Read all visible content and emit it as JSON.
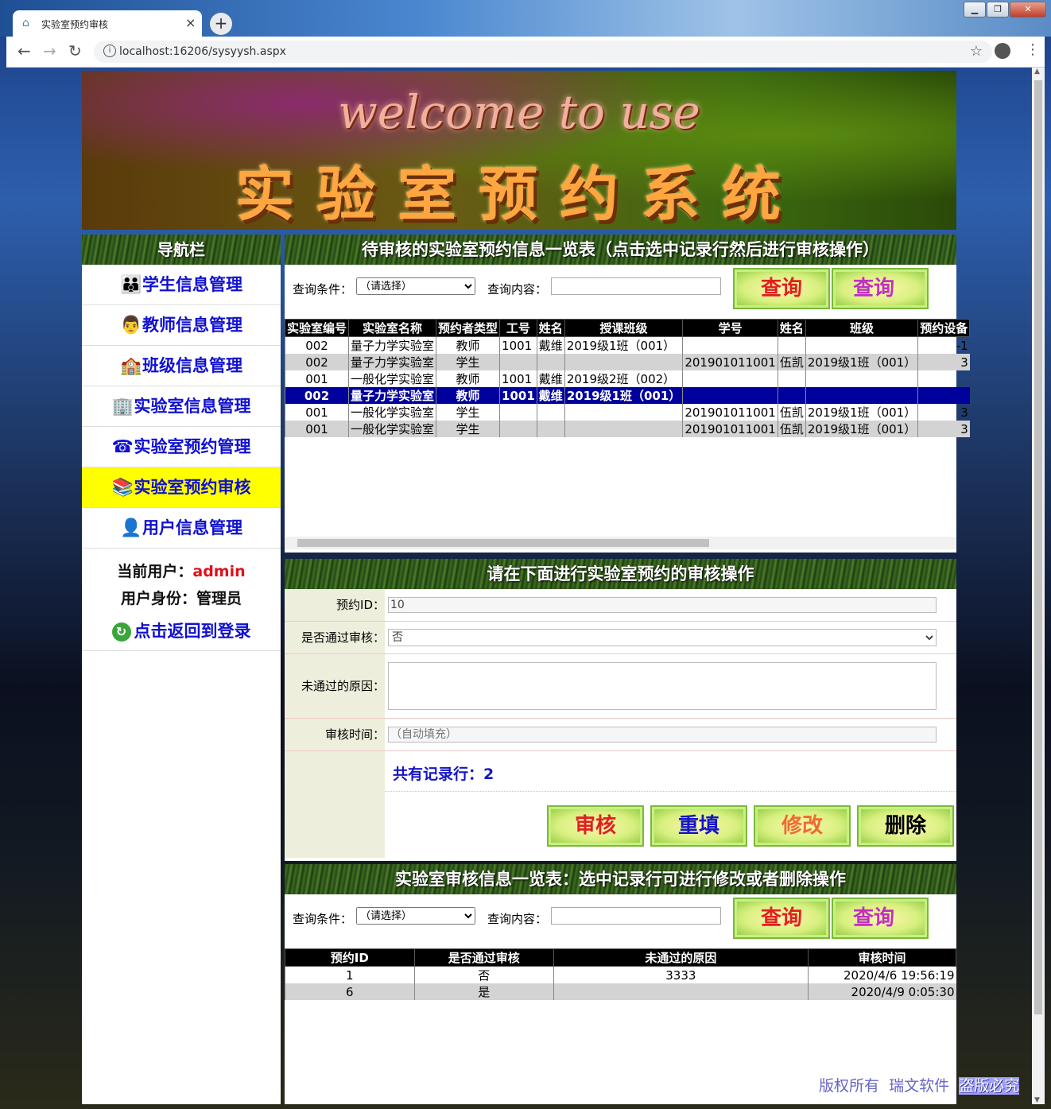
{
  "browser": {
    "tab_title": "实验室预约审核",
    "url": "localhost:16206/sysyysh.aspx",
    "tab_close": "×",
    "new_tab": "+",
    "window_buttons": [
      "▁",
      "❐",
      "✕"
    ]
  },
  "banner": {
    "welcome": "welcome to use",
    "title": "实验室预约系统"
  },
  "nav": {
    "header": "导航栏",
    "items": [
      {
        "label": "学生信息管理",
        "icon": "students-icon"
      },
      {
        "label": "教师信息管理",
        "icon": "teacher-icon"
      },
      {
        "label": "班级信息管理",
        "icon": "class-icon"
      },
      {
        "label": "实验室信息管理",
        "icon": "building-icon"
      },
      {
        "label": "实验室预约管理",
        "icon": "phone-icon"
      },
      {
        "label": "实验室预约审核",
        "icon": "review-icon"
      },
      {
        "label": "用户信息管理",
        "icon": "user-icon"
      }
    ],
    "active_index": 5,
    "current_user_label": "当前用户：",
    "current_user": "admin",
    "role_label": "用户身份：",
    "role": "管理员",
    "back_label": "点击返回到登录"
  },
  "pending": {
    "title": "待审核的实验室预约信息一览表（点击选中记录行然后进行审核操作）",
    "query_label": "查询条件：",
    "query_select": "（请选择）",
    "content_label": "查询内容：",
    "btn_query": "查询",
    "btn_query_all": "查询",
    "columns": [
      "实验室编号",
      "实验室名称",
      "预约者类型",
      "工号",
      "姓名",
      "授课班级",
      "学号",
      "姓名",
      "班级",
      "预约设备"
    ],
    "rows": [
      [
        "002",
        "量子力学实验室",
        "教师",
        "1001",
        "戴维",
        "2019级1班（001）",
        "",
        "",
        "",
        "-1"
      ],
      [
        "002",
        "量子力学实验室",
        "学生",
        "",
        "",
        "",
        "201901011001",
        "伍凯",
        "2019级1班（001）",
        "3"
      ],
      [
        "001",
        "一般化学实验室",
        "教师",
        "1001",
        "戴维",
        "2019级2班（002）",
        "",
        "",
        "",
        ""
      ],
      [
        "002",
        "量子力学实验室",
        "教师",
        "1001",
        "戴维",
        "2019级1班（001）",
        "",
        "",
        "",
        ""
      ],
      [
        "001",
        "一般化学实验室",
        "学生",
        "",
        "",
        "",
        "201901011001",
        "伍凯",
        "2019级1班（001）",
        "3"
      ],
      [
        "001",
        "一般化学实验室",
        "学生",
        "",
        "",
        "",
        "201901011001",
        "伍凯",
        "2019级1班（001）",
        "3"
      ]
    ],
    "selected_row": 3
  },
  "review": {
    "title": "请在下面进行实验室预约的审核操作",
    "id_label": "预约ID：",
    "id_value": "10",
    "pass_label": "是否通过审核：",
    "pass_value": "否",
    "reason_label": "未通过的原因：",
    "reason_value": "",
    "time_label": "审核时间：",
    "time_placeholder": "（自动填充）",
    "count_text": "共有记录行：2",
    "btn_review": "审核",
    "btn_reset": "重填",
    "btn_modify": "修改",
    "btn_delete": "删除"
  },
  "reviewed": {
    "title": "实验室审核信息一览表：选中记录行可进行修改或者删除操作",
    "query_label": "查询条件：",
    "query_select": "（请选择）",
    "content_label": "查询内容：",
    "btn_query": "查询",
    "btn_query_all": "查询",
    "columns": [
      "预约ID",
      "是否通过审核",
      "未通过的原因",
      "审核时间"
    ],
    "rows": [
      [
        "1",
        "否",
        "3333",
        "2020/4/6 19:56:19"
      ],
      [
        "6",
        "是",
        "",
        "2020/4/9 0:05:30"
      ]
    ]
  },
  "footer": {
    "a": "版权所有",
    "b": "瑞文软件",
    "c": "盗版必究"
  },
  "colors": {
    "nav_text": "#1010d0",
    "active_bg": "#ffff00",
    "selected_row_bg": "#00009c",
    "admin_red": "#e0101a"
  }
}
